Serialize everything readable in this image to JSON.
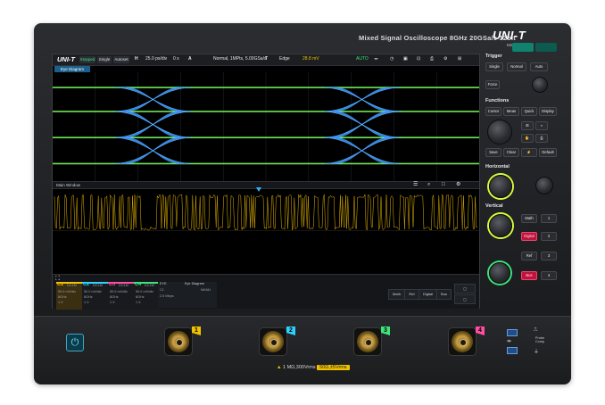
{
  "device": {
    "brand": "UNI-T",
    "title": "Mixed Signal Oscilloscope  8GHz 20GSa/s 12bit",
    "model": "MSO8000HD"
  },
  "screen": {
    "menu": {
      "logo": "UNI-T",
      "run_state": "Stopped",
      "single": "Single",
      "autoset": "Autoset",
      "horizontal_label": "H",
      "timebase": "25.0 ps/div",
      "delay": "0 s",
      "acq_label": "A",
      "acquire": "Normal, 1MPts, 5.00GSa/s",
      "trigger_label": "T",
      "trigger": "Edge",
      "trigger_level": "28.8 mV",
      "auto": "AUTO"
    },
    "eye_tab": "Eye Diagram",
    "main_window": "Main Window",
    "channels": [
      {
        "id": "C1",
        "coupling": "DC1M",
        "scale": "50.0 mV/div",
        "bw": "8GHz",
        "offset": "1 X",
        "color": "#f2c200"
      },
      {
        "id": "C2",
        "coupling": "DC1M",
        "scale": "50.0 mV/div",
        "bw": "8GHz",
        "offset": "1 X",
        "color": "#2fd2ff"
      },
      {
        "id": "C3",
        "coupling": "DC1M",
        "scale": "50.0 mV/div",
        "bw": "8GHz",
        "offset": "1 X",
        "color": "#ff4fa0"
      },
      {
        "id": "C4",
        "coupling": "DC1M",
        "scale": "50.0 mV/div",
        "bw": "8GHz",
        "offset": "1 X",
        "color": "#3ee37a"
      }
    ],
    "eye_panel": {
      "label": "EYE",
      "source": "C1",
      "rate": "2.5 Mbps",
      "mode": "Eye Diagram",
      "measure": "MANU"
    },
    "actions": [
      "Math",
      "Ref",
      "Digital",
      "Bus"
    ]
  },
  "panel": {
    "trigger_title": "Trigger",
    "trigger_buttons": [
      "Single",
      "Normal",
      "Auto"
    ],
    "force": "Force",
    "functions_title": "Functions",
    "function_buttons": [
      "Cursor",
      "Meas",
      "Quick",
      "Display"
    ],
    "clear_buttons": [
      "Save",
      "Clear",
      "Default"
    ],
    "horizontal_title": "Horizontal",
    "vertical_title": "Vertical",
    "channel_buttons": [
      "Math",
      "Digital",
      "Ref",
      "Bus"
    ],
    "channel_numbers": [
      "1",
      "2",
      "3",
      "4"
    ]
  },
  "front": {
    "warning": "1 MΩ,300Vrms",
    "warning_highlight": "50Ω,±5Vrms",
    "inputs": [
      {
        "num": "1",
        "color": "#f2c200"
      },
      {
        "num": "2",
        "color": "#2fd2ff"
      },
      {
        "num": "3",
        "color": "#3ee37a"
      },
      {
        "num": "4",
        "color": "#ff4fa0"
      }
    ],
    "probe_comp": "Probe Comp"
  },
  "chart_data": {
    "type": "eye-diagram",
    "channel": "C1",
    "eyes_visible": 2
  }
}
